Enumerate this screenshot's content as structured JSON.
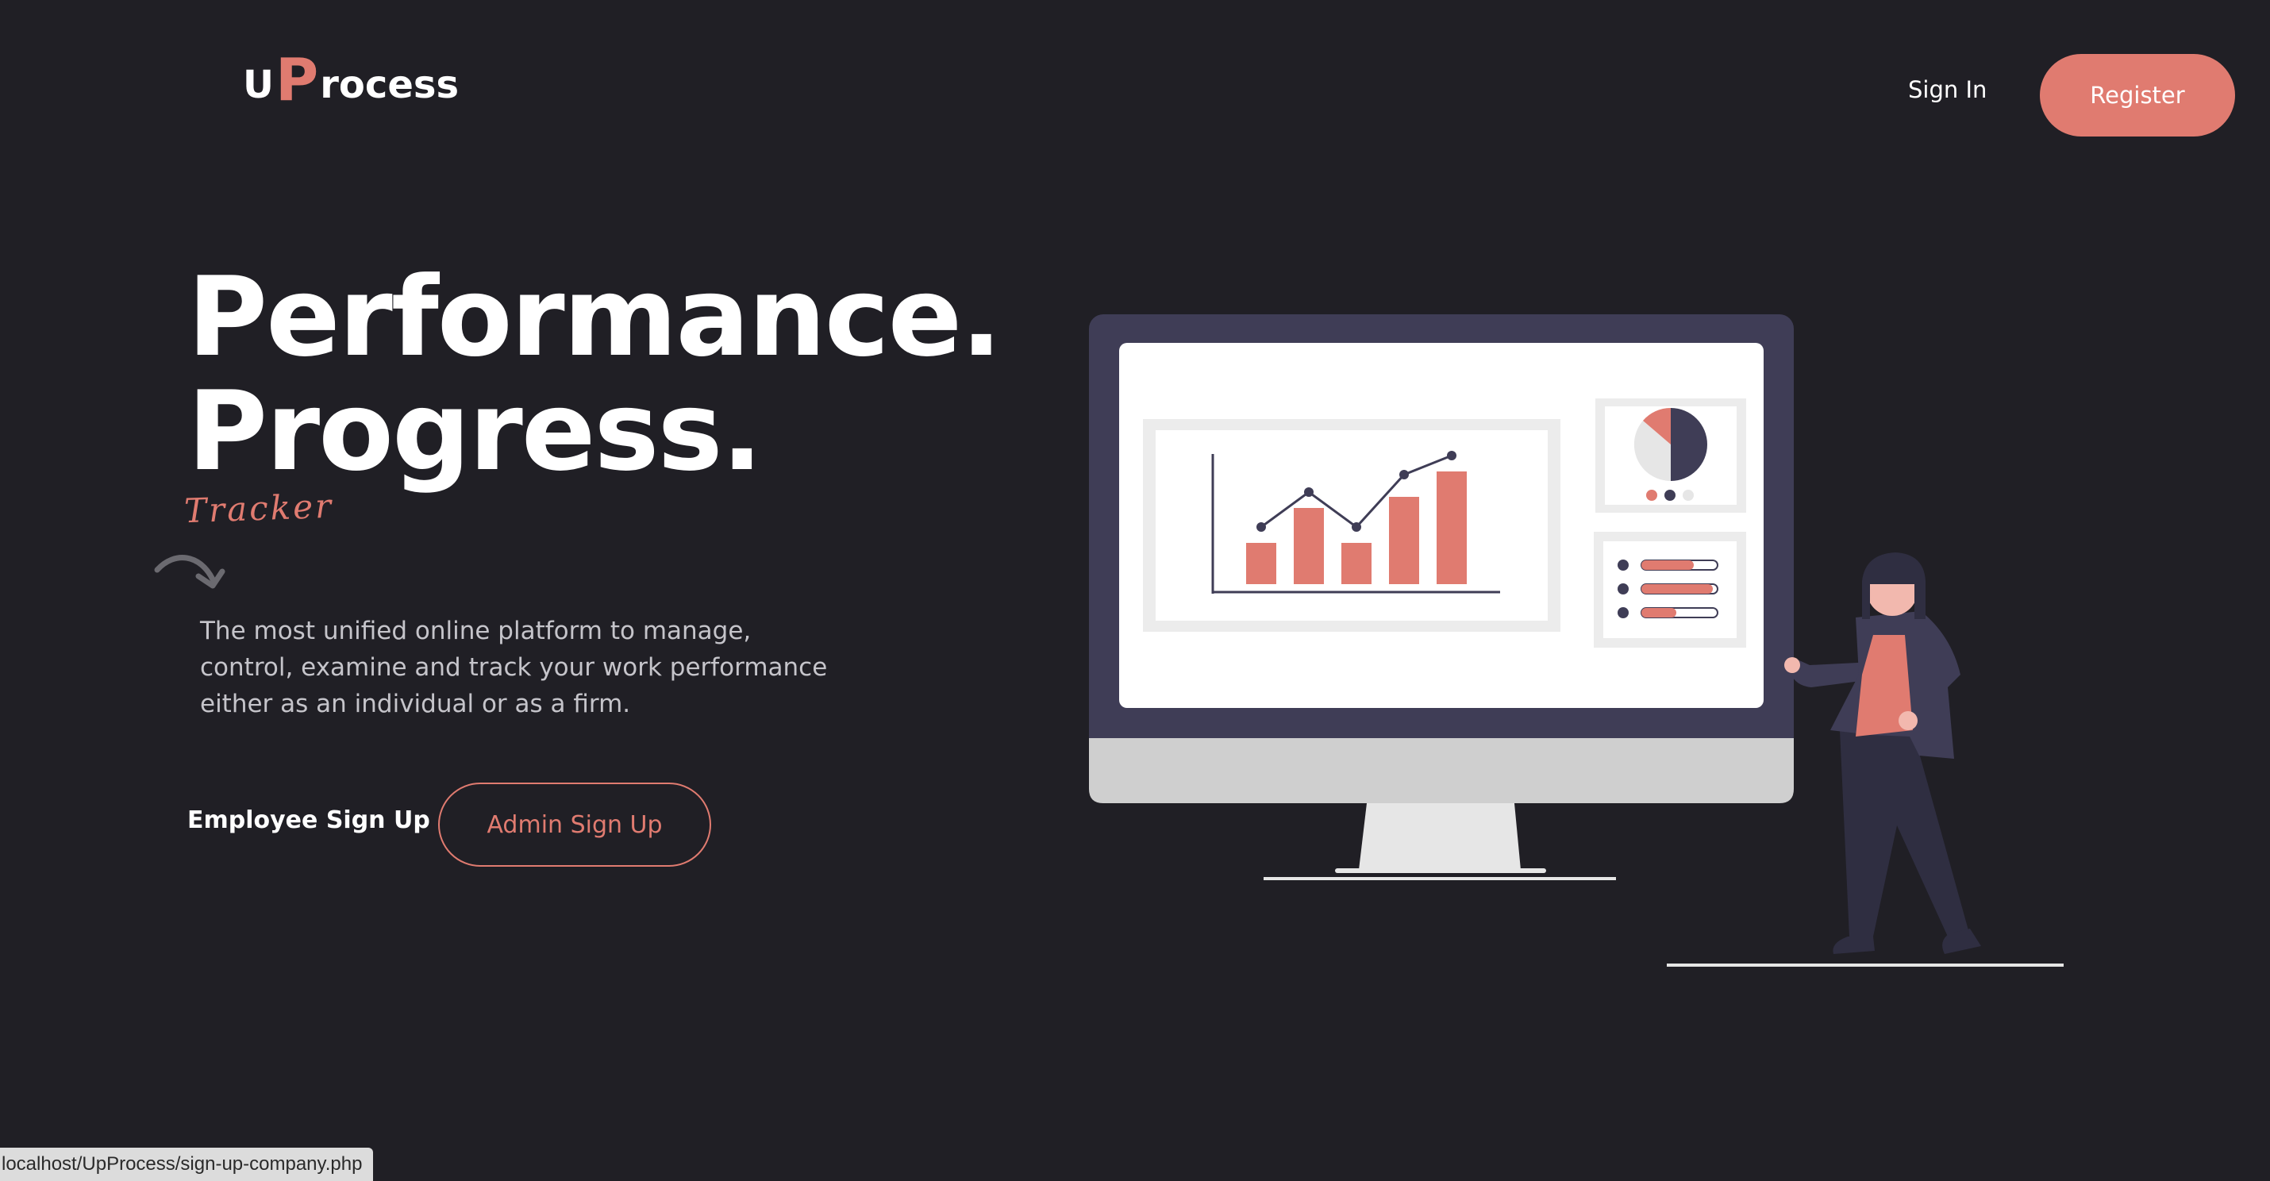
{
  "header": {
    "logo_u": "U",
    "logo_p": "P",
    "logo_rest": "rocess",
    "signin_label": "Sign In",
    "register_label": "Register"
  },
  "hero": {
    "title_line1": "Performance.",
    "title_line2": "Progress.",
    "tracker_text": "Tracker",
    "description": "The most unified online platform to manage, control, examine and track your work performance either as an individual or as a firm.",
    "employee_signup_label": "Employee Sign Up",
    "admin_signup_label": "Admin Sign Up"
  },
  "status_bar": {
    "url": "localhost/UpProcess/sign-up-company.php"
  },
  "colors": {
    "background": "#201f25",
    "accent": "#e07b70",
    "monitor_frame": "#3f3d56",
    "text_primary": "#ffffff",
    "text_secondary": "#c5c4ca"
  }
}
